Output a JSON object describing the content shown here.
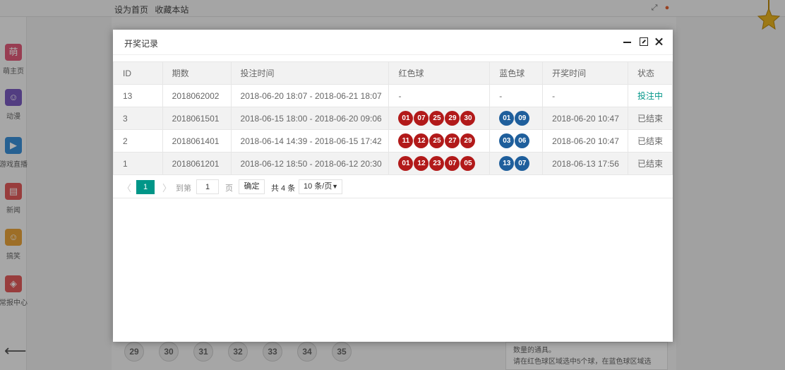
{
  "topbar": {
    "set_home": "设为首页",
    "bookmark": "收藏本站"
  },
  "sidebar": {
    "items": [
      {
        "icon_char": "萌",
        "label": "萌主页",
        "color": "#e05a7a"
      },
      {
        "icon_char": "☺",
        "label": "动漫",
        "color": "#7a5bbf"
      },
      {
        "icon_char": "▶",
        "label": "游戏直播",
        "color": "#3a8fd8"
      },
      {
        "icon_char": "▤",
        "label": "新闻",
        "color": "#e05a5a"
      },
      {
        "icon_char": "☺",
        "label": "搞笑",
        "color": "#e8a23a"
      },
      {
        "icon_char": "◈",
        "label": "常报中心",
        "color": "#e05a5a"
      }
    ]
  },
  "background": {
    "balls": [
      "29",
      "30",
      "31",
      "32",
      "33",
      "34",
      "35"
    ],
    "tip_line1": "数量的通具。",
    "tip_line2": "请在红色球区域选中5个球，在蓝色球区域选"
  },
  "dialog": {
    "title": "开奖记录",
    "columns": [
      "ID",
      "期数",
      "投注时间",
      "红色球",
      "蓝色球",
      "开奖时间",
      "状态"
    ],
    "rows": [
      {
        "id": "13",
        "period": "2018062002",
        "bet_time": "2018-06-20 18:07 - 2018-06-21 18:07",
        "red": [],
        "red_text": "-",
        "blue": [],
        "blue_text": "-",
        "draw_time": "-",
        "status": "投注中",
        "active": true
      },
      {
        "id": "3",
        "period": "2018061501",
        "bet_time": "2018-06-15 18:00 - 2018-06-20 09:06",
        "red": [
          "01",
          "07",
          "25",
          "29",
          "30"
        ],
        "blue": [
          "01",
          "09"
        ],
        "draw_time": "2018-06-20 10:47",
        "status": "已结束",
        "active": false
      },
      {
        "id": "2",
        "period": "2018061401",
        "bet_time": "2018-06-14 14:39 - 2018-06-15 17:42",
        "red": [
          "11",
          "12",
          "25",
          "27",
          "29"
        ],
        "blue": [
          "03",
          "06"
        ],
        "draw_time": "2018-06-20 10:47",
        "status": "已结束",
        "active": false
      },
      {
        "id": "1",
        "period": "2018061201",
        "bet_time": "2018-06-12 18:50 - 2018-06-12 20:30",
        "red": [
          "01",
          "12",
          "23",
          "07",
          "05"
        ],
        "blue": [
          "13",
          "07"
        ],
        "draw_time": "2018-06-13 17:56",
        "status": "已结束",
        "active": false
      }
    ],
    "pagination": {
      "current_page": "1",
      "goto_label": "到第",
      "goto_value": "1",
      "page_unit": "页",
      "confirm": "确定",
      "total": "共 4 条",
      "page_size": "10 条/页"
    }
  },
  "colors": {
    "accent": "#009688",
    "red_ball": "#b21a1a",
    "blue_ball": "#1f5f9c"
  }
}
